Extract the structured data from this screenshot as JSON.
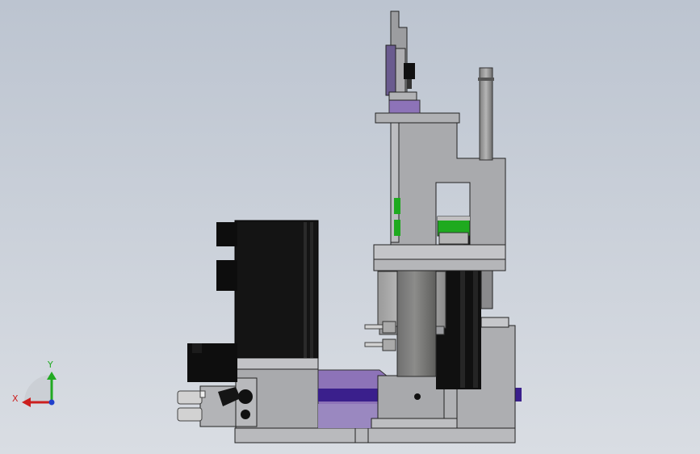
{
  "viewport": {
    "background_top": "#bcc4d0",
    "background_bottom": "#d9dde3"
  },
  "model": {
    "body_dark": "#121212",
    "body_gray": "#a7a8ab",
    "body_light": "#c4c5c8",
    "accent_green": "#1faa1f",
    "accent_purple": "#5a2fa0",
    "accent_violet": "#8d73b8"
  },
  "triad": {
    "x_label": "X",
    "y_label": "Y",
    "x_color": "#cc1f1f",
    "y_color": "#22aa22",
    "z_color": "#1f3fcc"
  }
}
